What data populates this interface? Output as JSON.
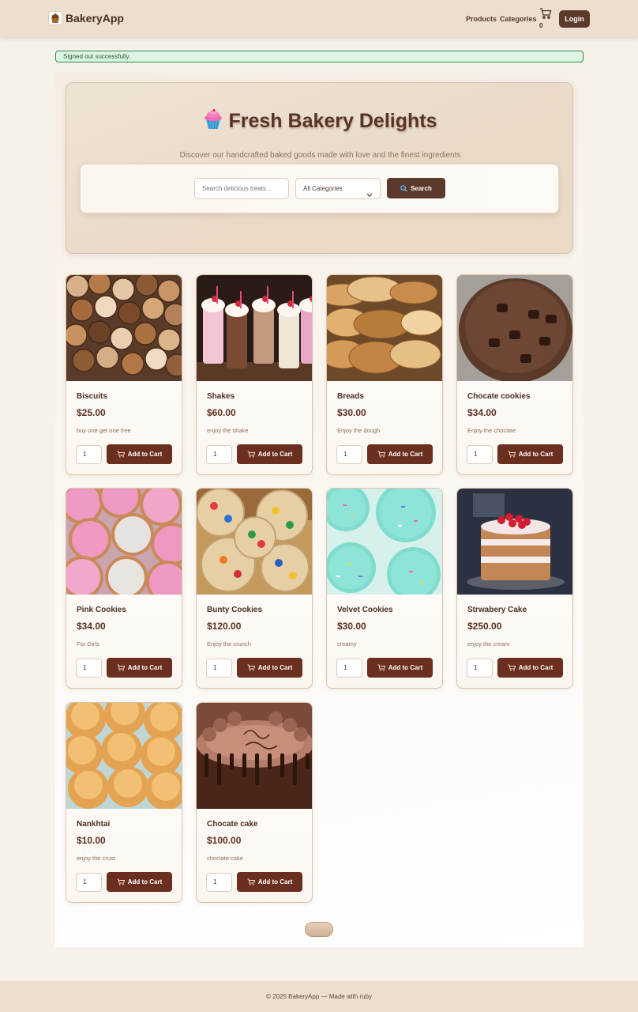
{
  "navbar": {
    "brand": "BakeryApp",
    "links": [
      "Products",
      "Categories"
    ],
    "cart_count": "0",
    "login_label": "Login"
  },
  "flash": {
    "message": "Signed out successfully."
  },
  "hero": {
    "title": "Fresh Bakery Delights",
    "subtitle": "Discover our handcrafted baked goods made with love and the finest ingredients",
    "search_placeholder": "Search delicious treats...",
    "category_selected": "All Categories",
    "search_button": "Search"
  },
  "products": [
    {
      "name": "Biscuits",
      "price": "$25.00",
      "description": "buy one get one free",
      "qty": "1",
      "add_label": "Add to Cart",
      "image": "biscuits"
    },
    {
      "name": "Shakes",
      "price": "$60.00",
      "description": "enjoy the shake",
      "qty": "1",
      "add_label": "Add to Cart",
      "image": "shakes"
    },
    {
      "name": "Breads",
      "price": "$30.00",
      "description": "Enjoy the dough",
      "qty": "1",
      "add_label": "Add to Cart",
      "image": "breads"
    },
    {
      "name": "Chocate cookies",
      "price": "$34.00",
      "description": "Enjoy the choclate",
      "qty": "1",
      "add_label": "Add to Cart",
      "image": "choc-cookie"
    },
    {
      "name": "Pink Cookies",
      "price": "$34.00",
      "description": "For Girls",
      "qty": "1",
      "add_label": "Add to Cart",
      "image": "pink-cookies"
    },
    {
      "name": "Bunty Cookies",
      "price": "$120.00",
      "description": "Enjoy the crunch",
      "qty": "1",
      "add_label": "Add to Cart",
      "image": "bunty-cookies"
    },
    {
      "name": "Velvet Cookies",
      "price": "$30.00",
      "description": "creamy",
      "qty": "1",
      "add_label": "Add to Cart",
      "image": "velvet-cookies"
    },
    {
      "name": "Strwabery Cake",
      "price": "$250.00",
      "description": "enjoy the cream",
      "qty": "1",
      "add_label": "Add to Cart",
      "image": "strawberry-cake"
    },
    {
      "name": "Nankhtai",
      "price": "$10.00",
      "description": "enjoy the crust",
      "qty": "1",
      "add_label": "Add to Cart",
      "image": "nankhtai"
    },
    {
      "name": "Chocate cake",
      "price": "$100.00",
      "description": "choclate cake",
      "qty": "1",
      "add_label": "Add to Cart",
      "image": "choc-cake"
    }
  ],
  "footer": {
    "text": "© 2025 BakeryApp — Made with ruby"
  },
  "colors": {
    "accent": "#5b3a2c",
    "add_button": "#6a2f1e",
    "navbar": "#ecdfcf",
    "flash_border": "#2f8a4a"
  }
}
